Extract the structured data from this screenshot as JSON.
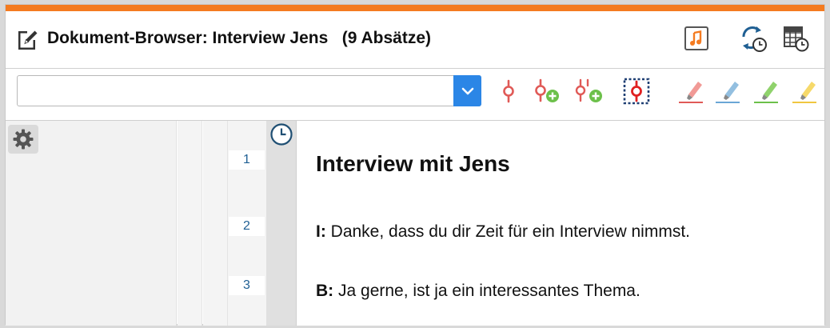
{
  "window": {
    "accent_color": "#f47b20",
    "title": "Dokument-Browser: Interview Jens   (9 Absätze)",
    "title_icon": "edit-document-icon",
    "buttons": [
      {
        "name": "media-player-icon"
      },
      {
        "name": "sync-timestamps-icon"
      },
      {
        "name": "timestamp-table-icon"
      }
    ]
  },
  "toolbar": {
    "search_value": "",
    "search_placeholder": "",
    "tools": [
      {
        "name": "code-pin-icon"
      },
      {
        "name": "add-code-pin-icon"
      },
      {
        "name": "add-code-stack-icon"
      },
      {
        "name": "code-selection-icon"
      },
      {
        "name": "highlighter-red-icon"
      },
      {
        "name": "highlighter-blue-icon"
      },
      {
        "name": "highlighter-green-icon"
      },
      {
        "name": "highlighter-yellow-icon"
      }
    ]
  },
  "sidebar": {
    "settings_icon": "gear-icon"
  },
  "paragraphs": [
    {
      "number": "1",
      "speaker": "",
      "text": "Interview mit Jens"
    },
    {
      "number": "2",
      "speaker": "I:",
      "text": " Danke, dass du dir Zeit für ein Interview nimmst."
    },
    {
      "number": "3",
      "speaker": "B:",
      "text": " Ja gerne, ist ja ein interessantes Thema."
    }
  ],
  "colors": {
    "link_number": "#1f5f93",
    "combo_button": "#2b86e6",
    "code_red": "#e05a57",
    "add_green": "#6cc04a"
  }
}
